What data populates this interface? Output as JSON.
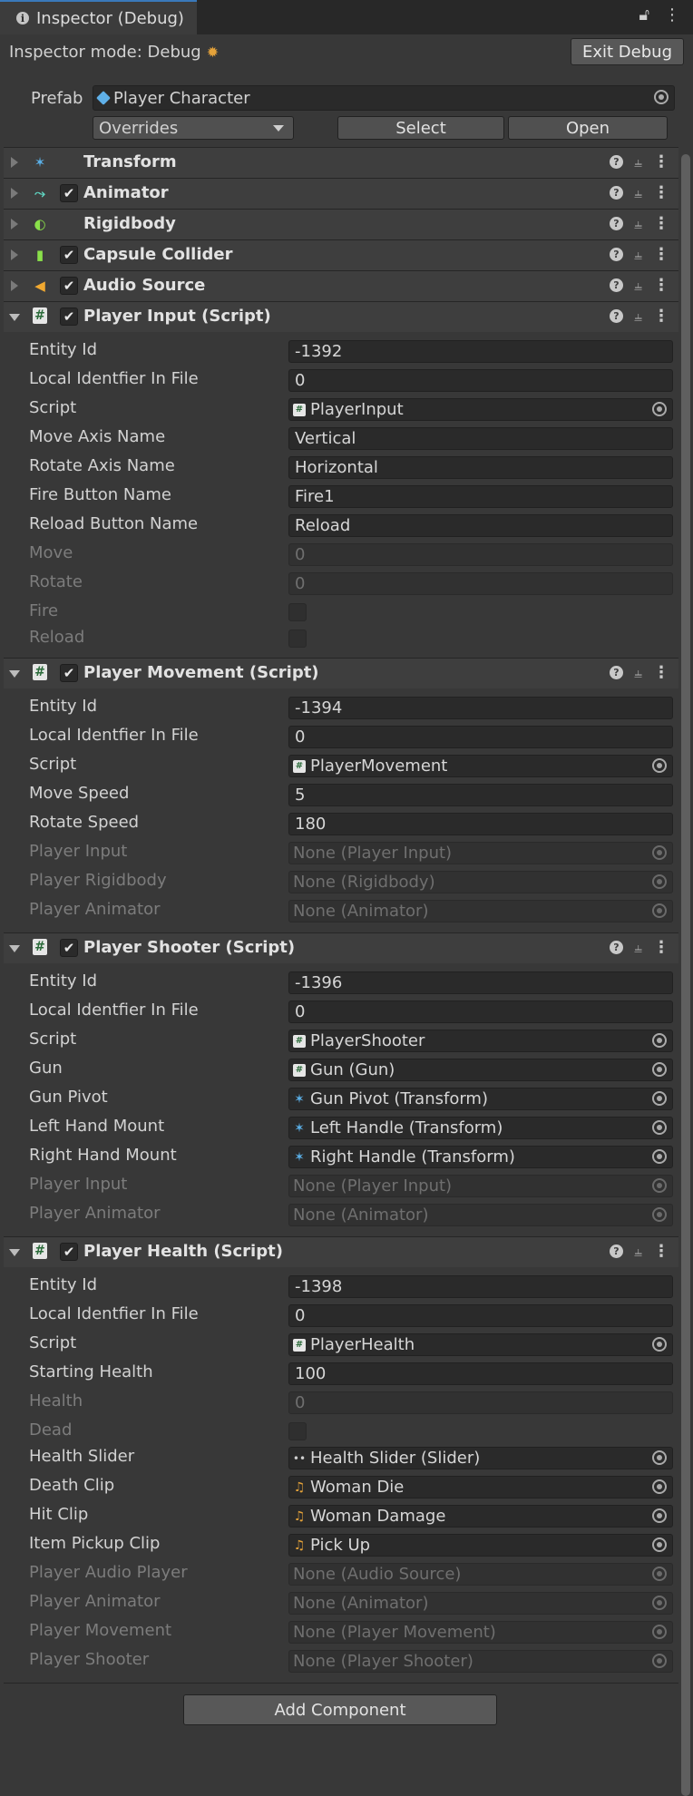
{
  "tab": {
    "title": "Inspector (Debug)"
  },
  "mode": {
    "label": "Inspector mode: Debug",
    "exit_label": "Exit Debug"
  },
  "prefab": {
    "label": "Prefab",
    "value": "Player Character",
    "overrides": "Overrides",
    "select": "Select",
    "open": "Open"
  },
  "collapsed_components": [
    {
      "name": "Transform",
      "icon": "transform-icon",
      "has_checkbox": false
    },
    {
      "name": "Animator",
      "icon": "animator-icon",
      "has_checkbox": true
    },
    {
      "name": "Rigidbody",
      "icon": "rigidbody-icon",
      "has_checkbox": false
    },
    {
      "name": "Capsule Collider",
      "icon": "capsule-collider-icon",
      "has_checkbox": true
    },
    {
      "name": "Audio Source",
      "icon": "audio-source-icon",
      "has_checkbox": true
    }
  ],
  "scripts": [
    {
      "title": "Player Input (Script)",
      "props": [
        {
          "label": "Entity Id",
          "value": "-1392",
          "type": "text"
        },
        {
          "label": "Local Identfier In File",
          "value": "0",
          "type": "text"
        },
        {
          "label": "Script",
          "value": "PlayerInput",
          "type": "obj",
          "icon": "script"
        },
        {
          "label": "Move Axis Name",
          "value": "Vertical",
          "type": "text"
        },
        {
          "label": "Rotate Axis Name",
          "value": "Horizontal",
          "type": "text"
        },
        {
          "label": "Fire Button Name",
          "value": "Fire1",
          "type": "text"
        },
        {
          "label": "Reload Button Name",
          "value": "Reload",
          "type": "text"
        },
        {
          "label": "Move",
          "value": "0",
          "type": "text",
          "dim": true
        },
        {
          "label": "Rotate",
          "value": "0",
          "type": "text",
          "dim": true
        },
        {
          "label": "Fire",
          "type": "check",
          "dim": true
        },
        {
          "label": "Reload",
          "type": "check",
          "dim": true
        }
      ]
    },
    {
      "title": "Player Movement (Script)",
      "props": [
        {
          "label": "Entity Id",
          "value": "-1394",
          "type": "text"
        },
        {
          "label": "Local Identfier In File",
          "value": "0",
          "type": "text"
        },
        {
          "label": "Script",
          "value": "PlayerMovement",
          "type": "obj",
          "icon": "script"
        },
        {
          "label": "Move Speed",
          "value": "5",
          "type": "text"
        },
        {
          "label": "Rotate Speed",
          "value": "180",
          "type": "text"
        },
        {
          "label": "Player Input",
          "value": "None (Player Input)",
          "type": "obj",
          "dim": true
        },
        {
          "label": "Player Rigidbody",
          "value": "None (Rigidbody)",
          "type": "obj",
          "dim": true
        },
        {
          "label": "Player Animator",
          "value": "None (Animator)",
          "type": "obj",
          "dim": true
        }
      ]
    },
    {
      "title": "Player Shooter (Script)",
      "props": [
        {
          "label": "Entity Id",
          "value": "-1396",
          "type": "text"
        },
        {
          "label": "Local Identfier In File",
          "value": "0",
          "type": "text"
        },
        {
          "label": "Script",
          "value": "PlayerShooter",
          "type": "obj",
          "icon": "script"
        },
        {
          "label": "Gun",
          "value": "Gun (Gun)",
          "type": "obj",
          "icon": "script"
        },
        {
          "label": "Gun Pivot",
          "value": "Gun Pivot (Transform)",
          "type": "obj",
          "icon": "xform"
        },
        {
          "label": "Left Hand Mount",
          "value": "Left Handle (Transform)",
          "type": "obj",
          "icon": "xform"
        },
        {
          "label": "Right Hand Mount",
          "value": "Right Handle (Transform)",
          "type": "obj",
          "icon": "xform"
        },
        {
          "label": "Player Input",
          "value": "None (Player Input)",
          "type": "obj",
          "dim": true
        },
        {
          "label": "Player Animator",
          "value": "None (Animator)",
          "type": "obj",
          "dim": true
        }
      ]
    },
    {
      "title": "Player Health (Script)",
      "props": [
        {
          "label": "Entity Id",
          "value": "-1398",
          "type": "text"
        },
        {
          "label": "Local Identfier In File",
          "value": "0",
          "type": "text"
        },
        {
          "label": "Script",
          "value": "PlayerHealth",
          "type": "obj",
          "icon": "script"
        },
        {
          "label": "Starting Health",
          "value": "100",
          "type": "text"
        },
        {
          "label": "Health",
          "value": "0",
          "type": "text",
          "dim": true
        },
        {
          "label": "Dead",
          "type": "check",
          "dim": true
        },
        {
          "label": "Health Slider",
          "value": "Health Slider (Slider)",
          "type": "obj",
          "icon": "slider"
        },
        {
          "label": "Death Clip",
          "value": "Woman Die",
          "type": "obj",
          "icon": "audio"
        },
        {
          "label": "Hit Clip",
          "value": "Woman Damage",
          "type": "obj",
          "icon": "audio"
        },
        {
          "label": "Item Pickup Clip",
          "value": "Pick Up",
          "type": "obj",
          "icon": "audio"
        },
        {
          "label": "Player Audio Player",
          "value": "None (Audio Source)",
          "type": "obj",
          "dim": true
        },
        {
          "label": "Player Animator",
          "value": "None (Animator)",
          "type": "obj",
          "dim": true
        },
        {
          "label": "Player Movement",
          "value": "None (Player Movement)",
          "type": "obj",
          "dim": true
        },
        {
          "label": "Player Shooter",
          "value": "None (Player Shooter)",
          "type": "obj",
          "dim": true
        }
      ]
    }
  ],
  "add_component": "Add Component"
}
